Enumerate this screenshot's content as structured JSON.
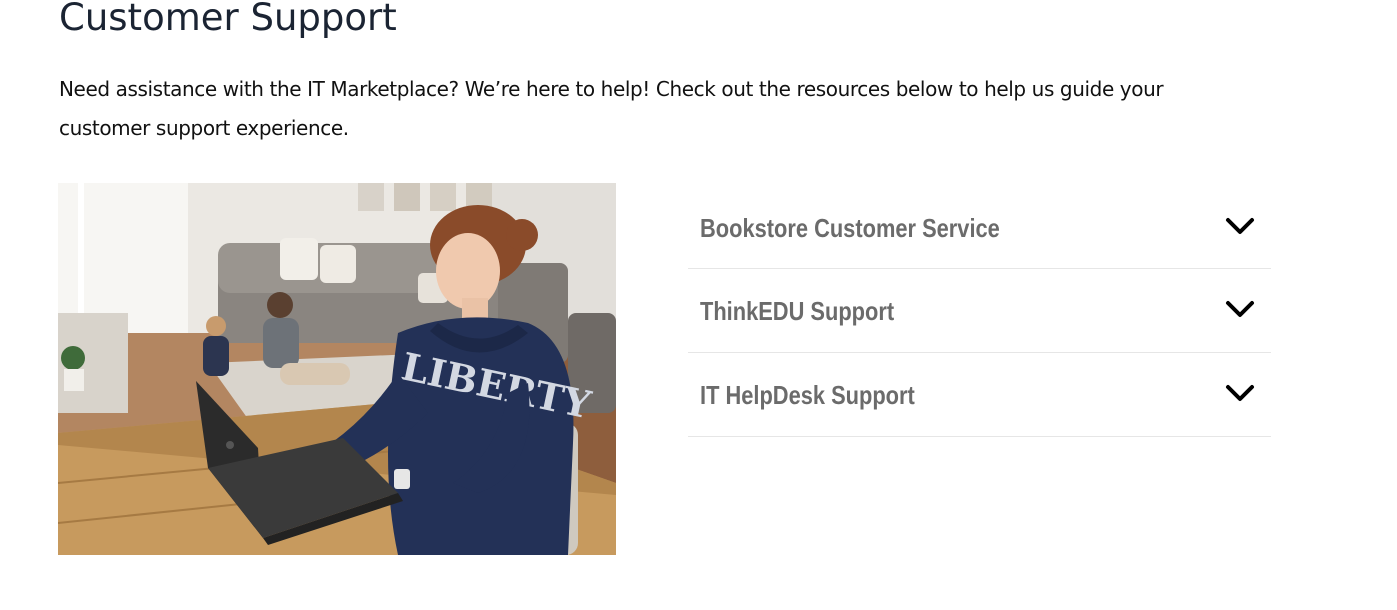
{
  "page": {
    "title": "Customer Support",
    "intro": "Need assistance with the IT Marketplace? We’re here to help!  Check out the resources below to help us guide your customer support experience."
  },
  "photo": {
    "sweatshirt_text": "LIBERTY"
  },
  "accordion": {
    "items": [
      {
        "label": "Bookstore Customer Service",
        "icon": "chevron-down-icon",
        "expanded": false
      },
      {
        "label": "ThinkEDU Support",
        "icon": "chevron-down-icon",
        "expanded": false
      },
      {
        "label": "IT HelpDesk Support",
        "icon": "chevron-down-icon",
        "expanded": false
      }
    ]
  },
  "colors": {
    "title": "#1b2433",
    "accordion_label": "#6b6b6b",
    "divider": "#e6e6e6",
    "chevron": "#000000"
  }
}
